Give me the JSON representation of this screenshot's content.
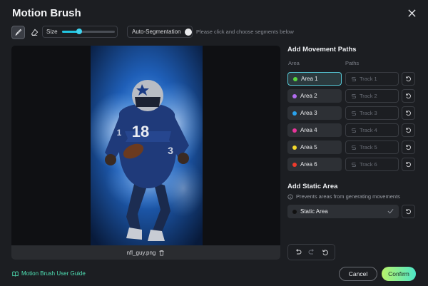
{
  "dialog": {
    "title": "Motion Brush",
    "close_icon": "close-icon"
  },
  "toolbar": {
    "brush_icon": "brush-icon",
    "eraser_icon": "eraser-icon",
    "size_label": "Size",
    "size_value_fraction": 0.33,
    "auto_seg_label": "Auto-Segmentation",
    "auto_seg_on": false,
    "hint": "Please click and choose segments below"
  },
  "canvas": {
    "file_name": "nfl_guy.png",
    "trash_icon": "trash-icon",
    "jersey_number": "18"
  },
  "movement": {
    "title": "Add Movement Paths",
    "area_header": "Area",
    "paths_header": "Paths",
    "rows": [
      {
        "area": "Area 1",
        "track": "Track 1",
        "color": "#5ad73f",
        "selected": true
      },
      {
        "area": "Area 2",
        "track": "Track 2",
        "color": "#b16cf0",
        "selected": false
      },
      {
        "area": "Area 3",
        "track": "Track 3",
        "color": "#2aa3ee",
        "selected": false
      },
      {
        "area": "Area 4",
        "track": "Track 4",
        "color": "#e8359a",
        "selected": false
      },
      {
        "area": "Area 5",
        "track": "Track 5",
        "color": "#f5d92c",
        "selected": false
      },
      {
        "area": "Area 6",
        "track": "Track 6",
        "color": "#ee3a2c",
        "selected": false
      }
    ]
  },
  "static": {
    "title": "Add Static Area",
    "info": "Prevents areas from generating movements",
    "label": "Static Area",
    "color": "#111111"
  },
  "footer": {
    "guide": "Motion Brush User Guide",
    "cancel": "Cancel",
    "confirm": "Confirm"
  }
}
